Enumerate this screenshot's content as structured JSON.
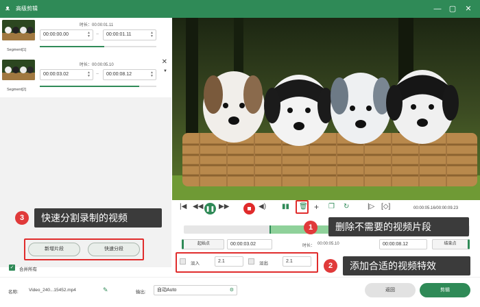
{
  "app": {
    "title": "高级剪辑"
  },
  "segments": [
    {
      "label": "Segment[1]",
      "duration_label": "时长：",
      "duration": "00:00:01.11",
      "start": "00:00:00.00",
      "end": "00:00:01.11",
      "progress": 0.55
    },
    {
      "label": "Segment[2]",
      "duration_label": "时长：",
      "duration": "00:00:05.10",
      "start": "00:00:03.02",
      "end": "00:00:08.12",
      "progress": 0.85
    }
  ],
  "left_panel": {
    "callout_text": "快速分割录制的视频",
    "new_segment_button": "新增片段",
    "quick_split_button": "快速分段",
    "merge_all_label": "合并所有",
    "merge_all_checked": true
  },
  "player": {
    "time_display": "00:00:05.16/00:00:09.23",
    "delete_callout": "删除不需要的视频片段",
    "effects_callout": "添加合适的视频特效"
  },
  "editor": {
    "start_button": "起始点",
    "start_value": "00:00:03.02",
    "duration_label": "时长：",
    "duration_value": "00:00:05.10",
    "end_value": "00:00:08.12",
    "end_button": "结束点",
    "fade_in_label": "淡入",
    "fade_in_value": "2.1",
    "fade_out_label": "淡出",
    "fade_out_value": "2.1"
  },
  "footer": {
    "name_label": "名称:",
    "name_value": "Video_240...15452.mp4",
    "output_label": "输出:",
    "output_value": "自动Auto",
    "back_button": "返回",
    "edit_button": "剪辑"
  },
  "badges": {
    "one": "1",
    "two": "2",
    "three": "3"
  },
  "colors": {
    "accent": "#2f8a57",
    "highlight": "#e02b2b",
    "callout_bg": "#3b3b3b"
  }
}
